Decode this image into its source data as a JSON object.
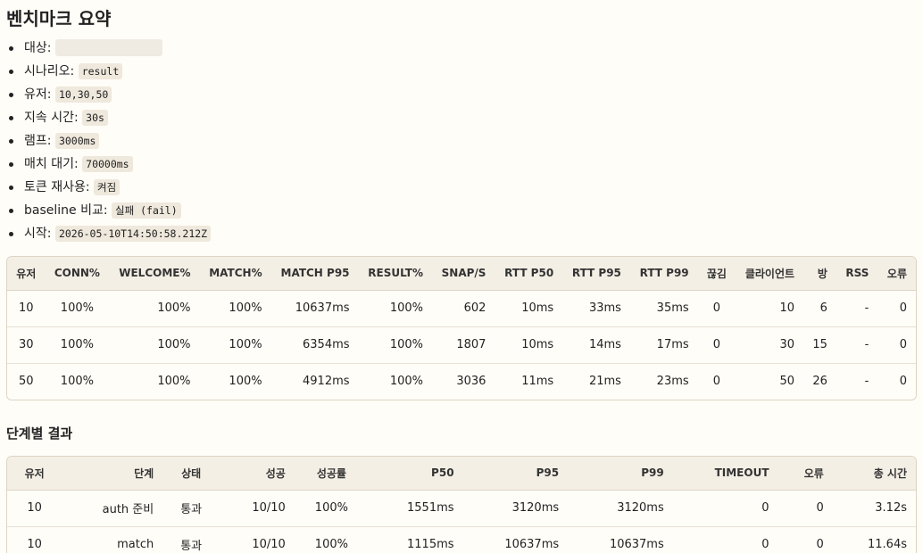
{
  "title": "벤치마크 요약",
  "meta": [
    {
      "label": "대상:",
      "value": ""
    },
    {
      "label": "시나리오:",
      "value": "result"
    },
    {
      "label": "유저:",
      "value": "10,30,50"
    },
    {
      "label": "지속 시간:",
      "value": "30s"
    },
    {
      "label": "램프:",
      "value": "3000ms"
    },
    {
      "label": "매치 대기:",
      "value": "70000ms"
    },
    {
      "label": "토큰 재사용:",
      "value": "켜짐"
    },
    {
      "label": "baseline 비교:",
      "value": "실패 (fail)"
    },
    {
      "label": "시작:",
      "value": "2026-05-10T14:50:58.212Z"
    }
  ],
  "summary": {
    "headers": [
      "유저",
      "CONN%",
      "WELCOME%",
      "MATCH%",
      "MATCH P95",
      "RESULT%",
      "SNAP/S",
      "RTT P50",
      "RTT P95",
      "RTT P99",
      "끊김",
      "클라이언트",
      "방",
      "RSS",
      "오류"
    ],
    "rows": [
      [
        "10",
        "100%",
        "100%",
        "100%",
        "10637ms",
        "100%",
        "602",
        "10ms",
        "33ms",
        "35ms",
        "0",
        "10",
        "6",
        "-",
        "0"
      ],
      [
        "30",
        "100%",
        "100%",
        "100%",
        "6354ms",
        "100%",
        "1807",
        "10ms",
        "14ms",
        "17ms",
        "0",
        "30",
        "15",
        "-",
        "0"
      ],
      [
        "50",
        "100%",
        "100%",
        "100%",
        "4912ms",
        "100%",
        "3036",
        "11ms",
        "21ms",
        "23ms",
        "0",
        "50",
        "26",
        "-",
        "0"
      ]
    ]
  },
  "stages_title": "단계별 결과",
  "stages": {
    "headers": [
      "유저",
      "단계",
      "상태",
      "성공",
      "성공률",
      "P50",
      "P95",
      "P99",
      "TIMEOUT",
      "오류",
      "총 시간"
    ],
    "rows": [
      [
        "10",
        "auth 준비",
        "통과",
        "10/10",
        "100%",
        "1551ms",
        "3120ms",
        "3120ms",
        "0",
        "0",
        "3.12s"
      ],
      [
        "10",
        "match",
        "통과",
        "10/10",
        "100%",
        "1115ms",
        "10637ms",
        "10637ms",
        "0",
        "0",
        "11.64s"
      ]
    ]
  }
}
